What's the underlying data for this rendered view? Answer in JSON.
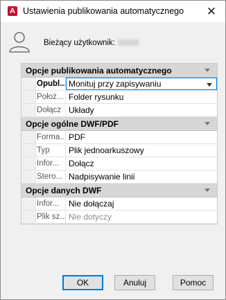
{
  "window": {
    "title": "Ustawienia publikowania automatycznego",
    "close_glyph": "✕"
  },
  "user": {
    "label": "Bieżący użytkownik:"
  },
  "categories": [
    {
      "label": "Opcje publikowania automatycznego",
      "rows": [
        {
          "name": "Opubl...",
          "value": "Monituj przy zapisywaniu",
          "selected": true,
          "dropdown": true
        },
        {
          "name": "Położ...",
          "value": "Folder rysunku"
        },
        {
          "name": "Dołącz",
          "value": "Układy"
        }
      ]
    },
    {
      "label": "Opcje ogólne DWF/PDF",
      "rows": [
        {
          "name": "Forma...",
          "value": "PDF"
        },
        {
          "name": "Typ",
          "value": "Plik jednoarkuszowy"
        },
        {
          "name": "Infor...",
          "value": "Dołącz"
        },
        {
          "name": "Stero...",
          "value": "Nadpisywanie linii"
        }
      ]
    },
    {
      "label": "Opcje danych DWF",
      "rows": [
        {
          "name": "Infor...",
          "value": "Nie dołączaj"
        },
        {
          "name": "Plik sz...",
          "value": "Nie dotyczy",
          "disabled": true
        }
      ]
    }
  ],
  "buttons": {
    "ok": "OK",
    "cancel": "Anuluj",
    "help": "Pomoc"
  },
  "colors": {
    "accent": "#0078d7",
    "app_icon": "#c8102e"
  }
}
